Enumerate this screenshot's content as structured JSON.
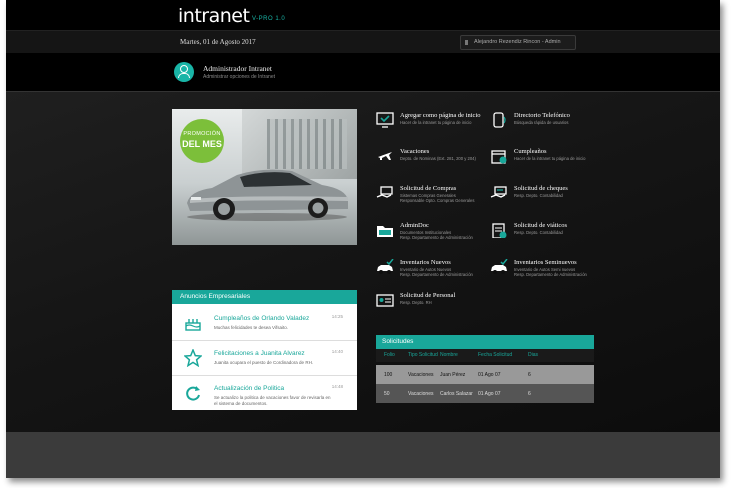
{
  "app": {
    "logo": "intranet",
    "version": "V-PRO 1.0"
  },
  "date_bar": {
    "date": "Martes, 01 de Agosto 2017",
    "user": "Alejandro Rezendiz Rincon - Admin"
  },
  "admin": {
    "title": "Administrador Intranet",
    "subtitle": "Administrar opciones de Intranet"
  },
  "promo": {
    "badge_line1": "PROMOCIÓN",
    "badge_line2": "DEL MES"
  },
  "ads": {
    "header": "Anuncios Empresariales",
    "items": [
      {
        "icon": "birthday-cake-icon",
        "title": "Cumpleaños de Orlando Valadez",
        "desc": "Muchas felicidades te desea Vifsaito.",
        "time": "14:25"
      },
      {
        "icon": "star-icon",
        "title": "Felicitaciones a Juanita Alvarez",
        "desc": "Juanita ocupara el puesto de Cordinadora de RH.",
        "time": "14:40"
      },
      {
        "icon": "refresh-icon",
        "title": "Actualización  de  Politica",
        "desc": "Se actualizo la politica de vacaciones favor de revisarla en el sistema de documentos.",
        "time": "14:48"
      }
    ]
  },
  "menu": [
    {
      "icon": "monitor-check-icon",
      "title": "Agregar como página de inicio",
      "sub": "Hacer de la intranet tu página de inicio"
    },
    {
      "icon": "phone-icon",
      "title": "Directorio Telefónico",
      "sub": "Búsqueda rápida de usuarios"
    },
    {
      "icon": "plane-icon",
      "title": "Vacaciones",
      "sub": "Depto. de Nominas (Ext. 281, 200 y 204)"
    },
    {
      "icon": "calendar-icon",
      "title": "Cumpleaños",
      "sub": "Hacer de la intranet tu página de inicio"
    },
    {
      "icon": "cash-hand-icon",
      "title": "Solicitud de Compras",
      "sub": "Sistemas Compras Generales\nResponsable Opto. Compras Generales"
    },
    {
      "icon": "check-hand-icon",
      "title": "Solicitud de cheques",
      "sub": "Resp. Depto. Contabilidad"
    },
    {
      "icon": "folder-icon",
      "title": "AdminDoc",
      "sub": "Documentos Institucionales\nResp. Departamento de Administración"
    },
    {
      "icon": "clipboard-check-icon",
      "title": "Solicitud de viáticos",
      "sub": "Resp. Depto. Contabilidad"
    },
    {
      "icon": "car-check-icon",
      "title": "Inventarios Nuevos",
      "sub": "Inventario de Autos Nuevos\nResp. Departamento de Administración"
    },
    {
      "icon": "car-check-icon",
      "title": "Inventarios Seminuevos",
      "sub": "Inventario de Autos Semi nuevos\nResp. Departamento de Administración"
    },
    {
      "icon": "id-card-icon",
      "title": "Solicitud de Personal",
      "sub": "Resp. Depto. RH"
    }
  ],
  "requests": {
    "header": "Solicitudes",
    "columns": [
      "Folio",
      "Tipo Solicitud",
      "Nombre",
      "Fecha Solicitud",
      "Dias"
    ],
    "rows": [
      [
        "100",
        "Vacaciones",
        "Juan Pérez",
        "01 Ago 07",
        "6"
      ],
      [
        "50",
        "Vacaciones",
        "Carlos Salazar",
        "01 Ago 07",
        "6"
      ]
    ]
  },
  "colors": {
    "accent": "#19a79a",
    "badge": "#7cbf3a"
  }
}
